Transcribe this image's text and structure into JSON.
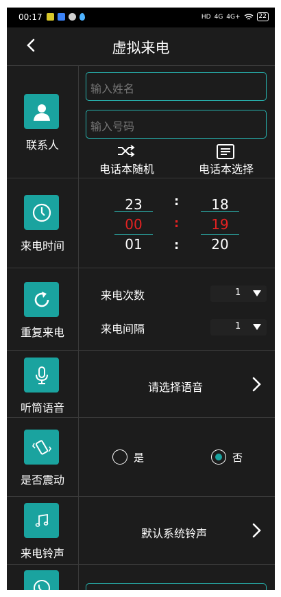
{
  "status_bar": {
    "time": "00:17",
    "network_badges": [
      "HD",
      "4G",
      "4G+"
    ],
    "battery": "22",
    "notification_icons": [
      "app-icon-yellow",
      "app-icon-blue",
      "wechat-icon",
      "drop-icon"
    ]
  },
  "header": {
    "title": "虚拟来电",
    "back_icon": "chevron-left-icon"
  },
  "contact": {
    "label": "联系人",
    "icon": "person-icon",
    "name_placeholder": "输入姓名",
    "number_placeholder": "输入号码",
    "random_label": "电话本随机",
    "random_icon": "shuffle-icon",
    "select_label": "电话本选择",
    "select_icon": "list-icon"
  },
  "call_time": {
    "label": "来电时间",
    "icon": "clock-icon",
    "hours": [
      "23",
      "00",
      "01"
    ],
    "minutes": [
      "18",
      "19",
      "20"
    ],
    "separator": ":"
  },
  "repeat": {
    "label": "重复来电",
    "icon": "refresh-icon",
    "count_label": "来电次数",
    "count_value": "1",
    "interval_label": "来电间隔",
    "interval_value": "1"
  },
  "voice": {
    "label": "听筒语音",
    "icon": "microphone-icon",
    "prompt": "请选择语音"
  },
  "vibrate": {
    "label": "是否震动",
    "icon": "vibrate-icon",
    "yes_label": "是",
    "no_label": "否",
    "selected": "否"
  },
  "ringtone": {
    "label": "来电铃声",
    "icon": "music-note-icon",
    "value": "默认系统铃声"
  },
  "colors": {
    "accent": "#1aa39f",
    "background": "#1c1c1c",
    "highlight": "#e52222"
  }
}
